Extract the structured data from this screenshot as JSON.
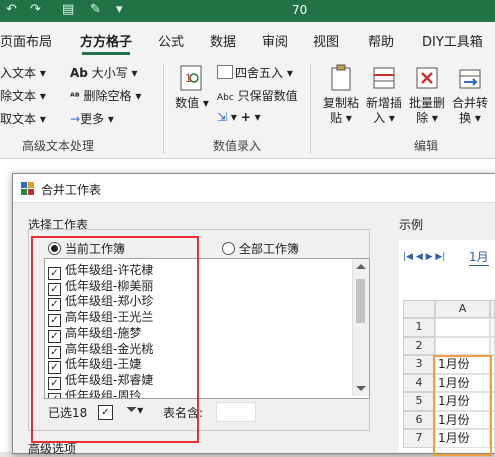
{
  "window": {
    "title": "70"
  },
  "ribbon_tabs": [
    "页面布局",
    "方方格子",
    "公式",
    "数据",
    "审阅",
    "视图",
    "帮助",
    "DIY工具箱"
  ],
  "active_tab": "方方格子",
  "ribbon": {
    "text_group": {
      "items": [
        "入文本",
        "除文本",
        "取文本"
      ],
      "size_btn": "大小写",
      "remove_space_btn": "删除空格",
      "more_btn": "更多",
      "label": "高级文本处理"
    },
    "number_group": {
      "number_btn": "数值",
      "round_btn": "四舍五入",
      "keep_value_btn": "只保留数值",
      "label": "数值录入"
    },
    "edit_group": {
      "copy_paste_btn": [
        "复制粘",
        "贴"
      ],
      "new_insert_btn": [
        "新增插",
        "入"
      ],
      "batch_delete_btn": [
        "批量删",
        "除"
      ],
      "merge_btn": [
        "合并转",
        "换"
      ],
      "label": "编辑"
    }
  },
  "dialog": {
    "title": "合并工作表",
    "select_label": "选择工作表",
    "example_label": "示例",
    "radio_current": "当前工作簿",
    "radio_all": "全部工作簿",
    "sheets": [
      "低年级组-许花棣",
      "低年级组-柳美丽",
      "低年级组-郑小珍",
      "高年级组-王光兰",
      "高年级组-施梦",
      "高年级组-金光桃",
      "低年级组-王婕",
      "低年级组-郑睿婕",
      "低年级组-周玲"
    ],
    "selected_count": "已选18",
    "sheet_name_label": "表名含:",
    "advanced_label": "高级选项"
  },
  "preview": {
    "col_header": "A",
    "row_numbers": [
      "1",
      "2",
      "3",
      "4",
      "5",
      "6",
      "7"
    ],
    "sheet_tab": "1月",
    "cells": [
      "1月份",
      "1月份",
      "1月份",
      "1月份",
      "1月份"
    ]
  },
  "colors": {
    "excel_green": "#217346",
    "highlight_red": "#e83030",
    "highlight_orange": "#f0a040"
  }
}
